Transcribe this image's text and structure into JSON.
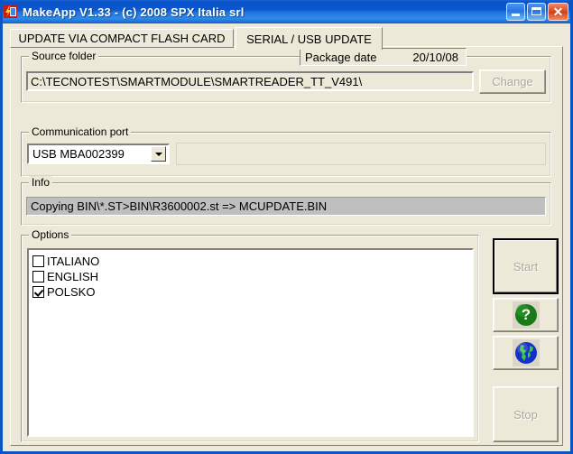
{
  "window": {
    "title": "MakeApp V1.33  -  (c) 2008 SPX Italia srl",
    "icon": "makeapp-icon",
    "controls": {
      "minimize": "minimize-icon",
      "maximize": "maximize-icon",
      "close": "✕"
    },
    "colors": {
      "titlebar_blue": "#0a52c8",
      "face": "#ece9d8",
      "close_red": "#d9491f",
      "info_bar": "#bfbfbf",
      "help_green": "#1a7a1a",
      "globe_blue": "#1430c8",
      "globe_green": "#3cc83c"
    }
  },
  "tabs": [
    {
      "label": "UPDATE VIA COMPACT FLASH CARD",
      "active": false
    },
    {
      "label": "SERIAL / USB UPDATE",
      "active": true
    }
  ],
  "source_folder": {
    "group_title": "Source folder",
    "path_value": "C:\\TECNOTEST\\SMARTMODULE\\SMARTREADER_TT_V491\\",
    "change_button": "Change",
    "change_disabled": true
  },
  "package_date": {
    "label": "Package date",
    "value": "20/10/08"
  },
  "communication_port": {
    "group_title": "Communication port",
    "selected": "USB MBA002399",
    "dropdown_icon": "chevron-down-icon"
  },
  "info": {
    "group_title": "Info",
    "message": "Copying BIN\\*.ST>BIN\\R3600002.st => MCUPDATE.BIN"
  },
  "options": {
    "group_title": "Options",
    "items": [
      {
        "label": "ITALIANO",
        "checked": false
      },
      {
        "label": "ENGLISH",
        "checked": false
      },
      {
        "label": "POLSKO",
        "checked": true
      }
    ]
  },
  "actions": {
    "start": {
      "label": "Start",
      "disabled": true,
      "focused": true
    },
    "help": {
      "icon": "question-mark-icon",
      "glyph": "?"
    },
    "globe": {
      "icon": "globe-icon"
    },
    "stop": {
      "label": "Stop",
      "disabled": true
    }
  }
}
